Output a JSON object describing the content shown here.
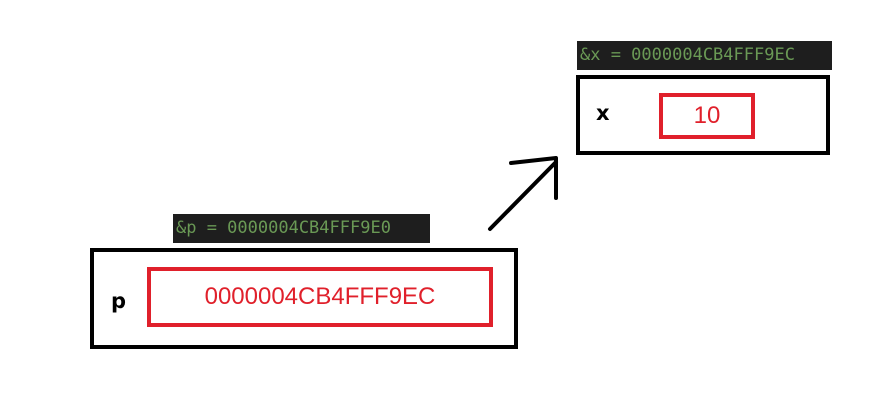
{
  "x_variable": {
    "address_label": "&x = 0000004CB4FFF9EC",
    "name": "x",
    "value": "10"
  },
  "p_variable": {
    "address_label": "&p = 0000004CB4FFF9E0",
    "name": "p",
    "value": "0000004CB4FFF9EC"
  },
  "colors": {
    "box_border": "#000000",
    "value_color": "#e0202b",
    "label_background": "#1e1e1e",
    "label_text": "#6a9955"
  }
}
